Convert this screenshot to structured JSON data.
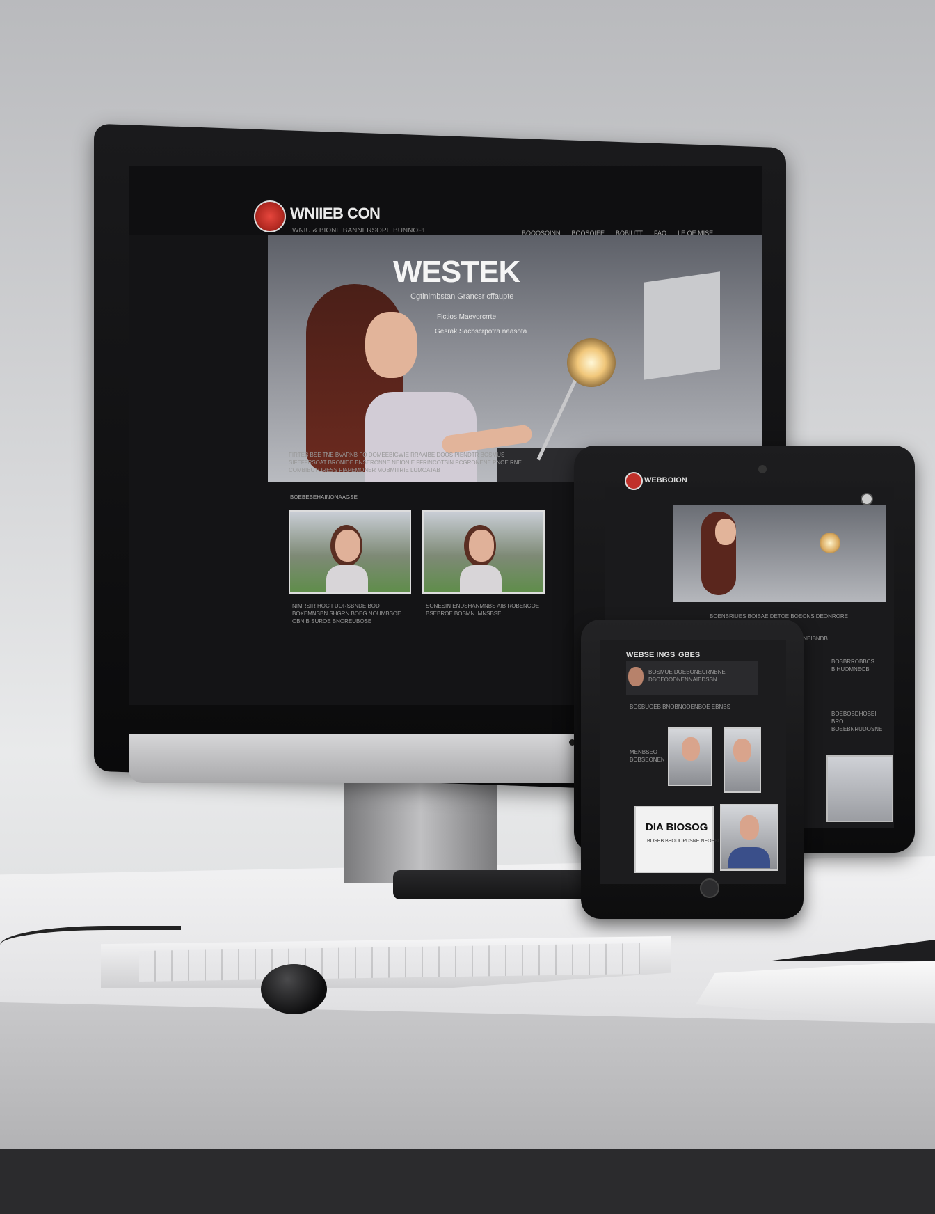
{
  "site": {
    "logo": "WNIIEB CON",
    "tagline": "WNIU & BIONE BANNERSOPE BUNNOPE",
    "nav": [
      "BOOOSOINN",
      "BOOSOIEE",
      "BOBIUTT",
      "FAQ",
      "LE OE MISE"
    ],
    "hero": {
      "title": "WESTEK",
      "subtitle": "Cgtinlmbstan Grancsr cffaupte",
      "line2": "Fictios Maevorcrrte",
      "line3": "Gesrak Sacbscrpotra naasota"
    },
    "intro_text": "FIRTEB BSE TNE BVARNB FO DOMEEBIGWIE RRAAIBE DOOS PIENDTR BOSMUS SIFEFFRSOAT BRONIDE BNSERONNE NEIONIE FFRINCOTSIN PCGRONENE PNOE RNE COMBIBUTORESS FIAPEMONER MOBMITRIE LUMOATAB",
    "section_label": "BOEBEBEHAINONAAGSE",
    "captions": [
      "NIMRSIR HOC FUORSBNDE BOD BOXEMNSBN SHGRN BOEG NOUMBSOE OBNIB SUROE BNOREUBOSE",
      "SONESIN ENDSHANMNBS AIB ROBENCOE BSEBROE BOSMN IMNSBSE"
    ]
  },
  "tablet": {
    "logo": "WEBBOION",
    "text": [
      "BOENBRIUES BOIBAE DETOE BOEONSIDEONRORE",
      "BOEBNEIBNDB",
      "BOSBRROBBCS BIHUOMNEOB",
      "BOEBOBDHOBEI BRO BOEEBNRUDOSNE"
    ]
  },
  "phone": {
    "title": "WEBSE INGS",
    "title2": "GBES",
    "banner_text": "BOSMUE DOEBONEURNBNE DBOEOODNENNAIEDSSN",
    "row_text": "BOSBUOEB BNOBNODENBOE EBNBS",
    "side_text": "MENBSEO BOBSEONEN",
    "card_title": "DIA BIOSOG",
    "card_sub": "BOSEB BBOUOPUSNE NEOSBOS"
  }
}
